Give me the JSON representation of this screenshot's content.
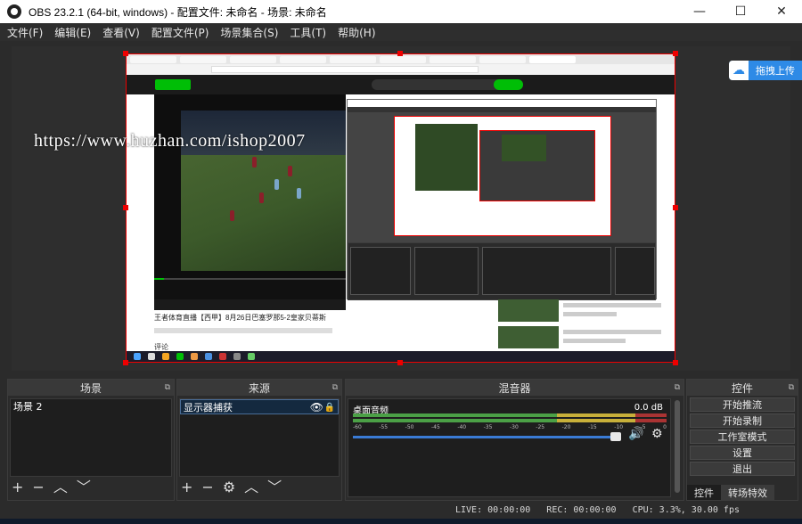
{
  "window": {
    "title": "OBS 23.2.1 (64-bit, windows) - 配置文件: 未命名 - 场景: 未命名",
    "minimize": "—",
    "maximize": "☐",
    "close": "✕"
  },
  "menu": [
    "文件(F)",
    "编辑(E)",
    "查看(V)",
    "配置文件(P)",
    "场景集合(S)",
    "工具(T)",
    "帮助(H)"
  ],
  "preview": {
    "watermark": "https://www.huzhan.com/ishop2007",
    "upload_label": "拖拽上传",
    "video_title": "王者体育直播【西甲】8月26日巴塞罗那5-2皇家贝蒂斯",
    "comment_label": "评论"
  },
  "scenes": {
    "header": "场景",
    "items": [
      "场景 2"
    ]
  },
  "sources": {
    "header": "来源",
    "items": [
      {
        "label": "显示器捕获"
      }
    ]
  },
  "mixer": {
    "header": "混音器",
    "channel": "桌面音频",
    "level": "0.0 dB",
    "ticks": [
      "-60",
      "-55",
      "-50",
      "-45",
      "-40",
      "-35",
      "-30",
      "-25",
      "-20",
      "-15",
      "-10",
      "-5",
      "0"
    ]
  },
  "controls": {
    "header": "控件",
    "buttons": [
      "开始推流",
      "开始录制",
      "工作室模式",
      "设置",
      "退出"
    ],
    "tabs": [
      "控件",
      "转场特效"
    ]
  },
  "status": {
    "live": "LIVE: 00:00:00",
    "rec": "REC: 00:00:00",
    "cpu": "CPU: 3.3%, 30.00 fps"
  },
  "colors": {
    "accent": "#3a7bd5",
    "selection_border": "#e00000",
    "meter_green": "#4ba046"
  }
}
